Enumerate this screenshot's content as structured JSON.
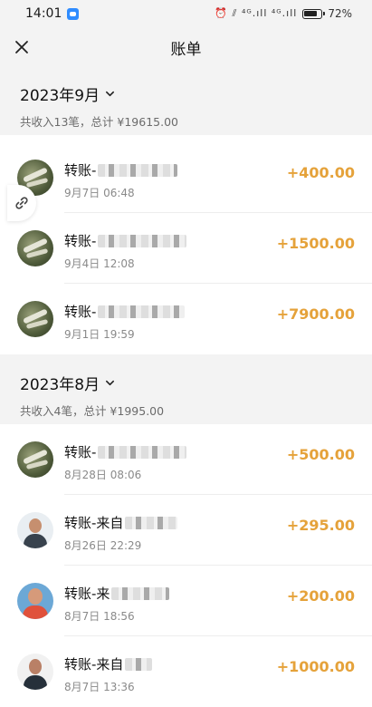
{
  "status_bar": {
    "time": "14:01",
    "signal_text": "⏰ ⫽ ⁴ᴳ.ıll ⁴ᴳ.ıll",
    "battery_percent": "72%"
  },
  "header": {
    "title": "账单"
  },
  "months": [
    {
      "title": "2023年9月",
      "summary": "共收入13笔，总计 ¥19615.00",
      "transactions": [
        {
          "name": "转账-",
          "time": "9月7日 06:48",
          "amount": "+400.00"
        },
        {
          "name": "转账-",
          "time": "9月4日 12:08",
          "amount": "+1500.00"
        },
        {
          "name": "转账-",
          "time": "9月1日 19:59",
          "amount": "+7900.00"
        }
      ]
    },
    {
      "title": "2023年8月",
      "summary": "共收入4笔，总计 ¥1995.00",
      "transactions": [
        {
          "name": "转账-",
          "time": "8月28日 08:06",
          "amount": "+500.00"
        },
        {
          "name": "转账-来自",
          "time": "8月26日 22:29",
          "amount": "+295.00"
        },
        {
          "name": "转账-来",
          "time": "8月7日 18:56",
          "amount": "+200.00"
        },
        {
          "name": "转账-来自",
          "time": "8月7日 13:36",
          "amount": "+1000.00"
        }
      ]
    }
  ],
  "colors": {
    "amount": "#e5a23a",
    "background": "#f3f3f3",
    "card": "#ffffff"
  },
  "icons": {
    "close": "close-icon",
    "chevron": "chevron-down-icon",
    "link": "link-icon"
  }
}
